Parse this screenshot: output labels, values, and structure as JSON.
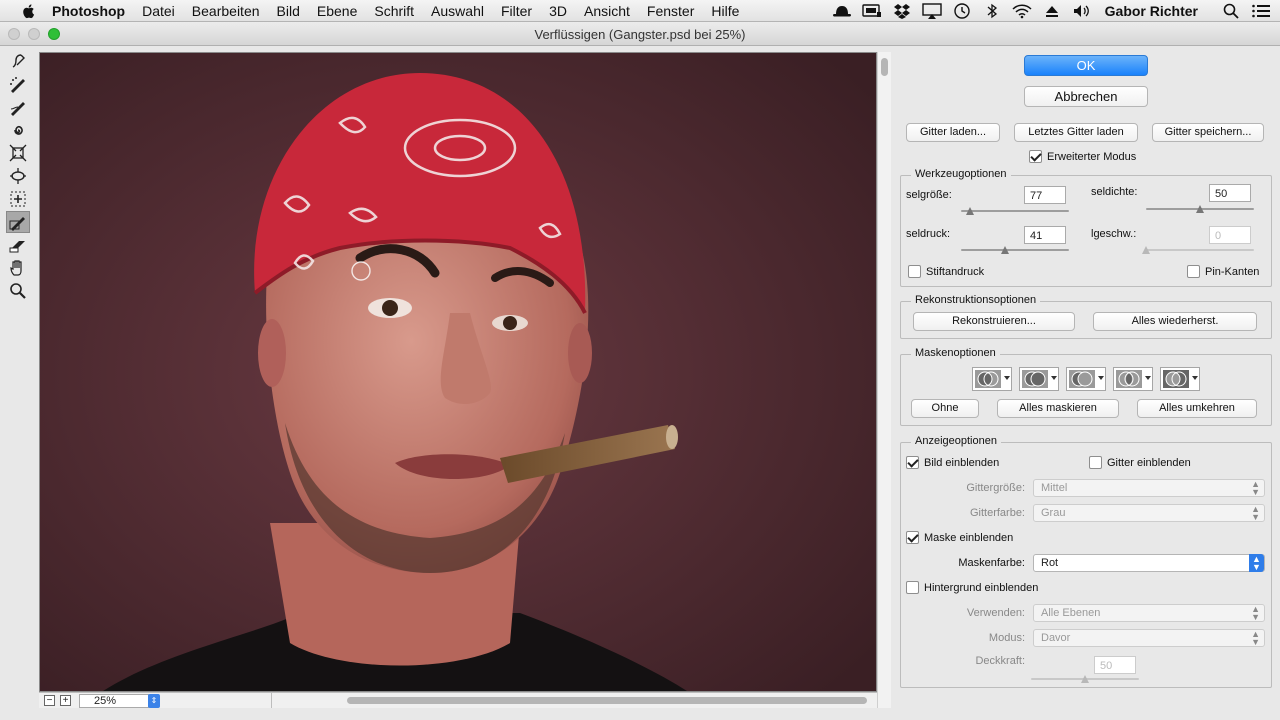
{
  "menubar": {
    "app_name": "Photoshop",
    "menus": [
      "Datei",
      "Bearbeiten",
      "Bild",
      "Ebene",
      "Schrift",
      "Auswahl",
      "Filter",
      "3D",
      "Ansicht",
      "Fenster",
      "Hilfe"
    ],
    "user": "Gabor Richter",
    "status_icons": [
      "hat-icon",
      "display-icon",
      "dropbox-icon",
      "airplay-icon",
      "time-machine-icon",
      "bluetooth-icon",
      "wifi-icon",
      "eject-icon",
      "volume-icon"
    ]
  },
  "window": {
    "title": "Verflüssigen (Gangster.psd bei 25%)"
  },
  "tools": [
    "forward-warp-tool-icon",
    "reconstruct-tool-icon",
    "smooth-tool-icon",
    "twirl-tool-icon",
    "pucker-tool-icon",
    "bloat-tool-icon",
    "push-left-tool-icon",
    "freeze-mask-tool-icon",
    "thaw-mask-tool-icon",
    "hand-tool-icon",
    "zoom-tool-icon"
  ],
  "canvas": {
    "zoom": "25%",
    "zoom_out": "−",
    "zoom_in": "+"
  },
  "panel": {
    "ok": "OK",
    "cancel": "Abbrechen",
    "load_mesh": "Gitter laden...",
    "load_last_mesh": "Letztes Gitter laden",
    "save_mesh": "Gitter speichern...",
    "advanced_mode": "Erweiterter Modus",
    "tool_options": {
      "legend": "Werkzeugoptionen",
      "size_label": "selgröße:",
      "size_value": "77",
      "size_level": 0.08,
      "density_label": "seldichte:",
      "density_value": "50",
      "density_level": 0.5,
      "pressure_label": "seldruck:",
      "pressure_value": "41",
      "pressure_level": 0.41,
      "rate_label": "lgeschw.:",
      "rate_value": "0",
      "rate_level": 0,
      "stylus": "Stiftandruck",
      "pin_edges": "Pin-Kanten"
    },
    "reconstruct": {
      "legend": "Rekonstruktionsoptionen",
      "reconstruct": "Rekonstruieren...",
      "restore_all": "Alles wiederherst."
    },
    "mask": {
      "legend": "Maskenoptionen",
      "icons": [
        "mask-replace-icon",
        "mask-add-icon",
        "mask-subtract-icon",
        "mask-intersect-icon",
        "mask-invert-icon"
      ],
      "none": "Ohne",
      "mask_all": "Alles maskieren",
      "invert_all": "Alles umkehren"
    },
    "view": {
      "legend": "Anzeigeoptionen",
      "show_image": "Bild einblenden",
      "show_mesh": "Gitter einblenden",
      "mesh_size_label": "Gittergröße:",
      "mesh_size_value": "Mittel",
      "mesh_color_label": "Gitterfarbe:",
      "mesh_color_value": "Grau",
      "show_mask": "Maske einblenden",
      "mask_color_label": "Maskenfarbe:",
      "mask_color_value": "Rot",
      "show_backdrop": "Hintergrund einblenden",
      "use_label": "Verwenden:",
      "use_value": "Alle Ebenen",
      "mode_label": "Modus:",
      "mode_value": "Davor",
      "opacity_label": "Deckkraft:",
      "opacity_value": "50",
      "opacity_level": 0.5
    }
  },
  "colors": {
    "accent": "#1a82fb",
    "bandana": "#c8283a",
    "backdrop": "#4a2a30"
  }
}
